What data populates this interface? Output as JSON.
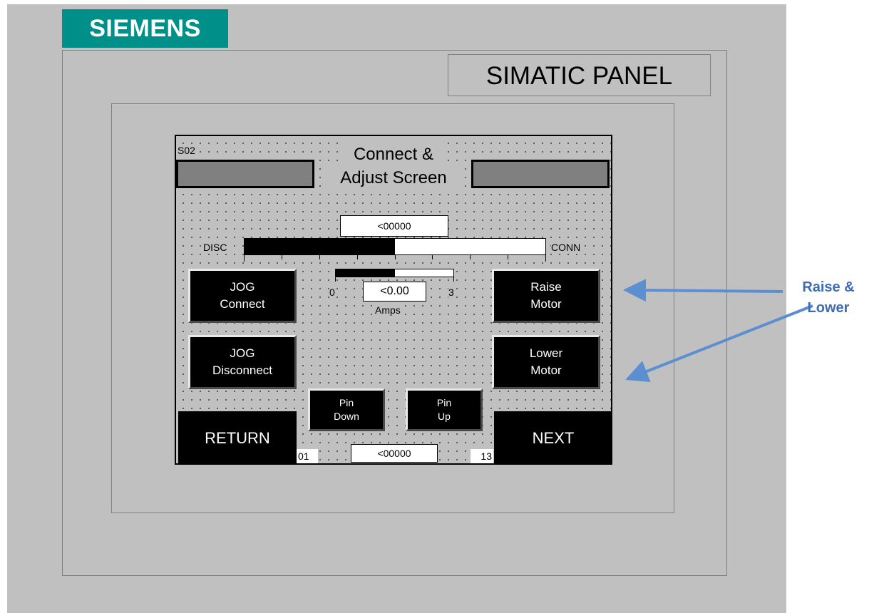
{
  "brand": {
    "logo_text": "SIEMENS",
    "panel_label": "SIMATIC PANEL",
    "logo_color": "#00908a"
  },
  "screen": {
    "id": "S02",
    "title_line1": "Connect &",
    "title_line2": "Adjust Screen",
    "position_readout": "<00000",
    "position_bar": {
      "left_label": "DISC",
      "right_label": "CONN",
      "fill_fraction": 0.5
    },
    "amps_meter": {
      "min_label": "0",
      "max_label": "3",
      "readout": "<0.00",
      "unit": "Amps",
      "fill_fraction": 0.5
    },
    "buttons": {
      "jog_connect": [
        "JOG",
        "Connect"
      ],
      "jog_disconnect": [
        "JOG",
        "Disconnect"
      ],
      "raise_motor": [
        "Raise",
        "Motor"
      ],
      "lower_motor": [
        "Lower",
        "Motor"
      ],
      "pin_down": [
        "Pin",
        "Down"
      ],
      "pin_up": [
        "Pin",
        "Up"
      ],
      "return": "RETURN",
      "next": "NEXT"
    },
    "footer": {
      "left_index": "01",
      "readout": "<00000",
      "right_index": "13"
    }
  },
  "annotation": {
    "line1": "Raise &",
    "line2": "Lower",
    "color": "#3c6db4"
  }
}
